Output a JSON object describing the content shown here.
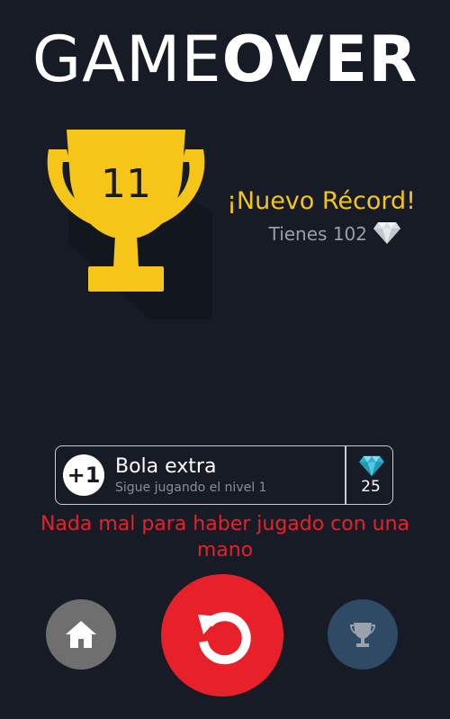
{
  "title": {
    "part1": "GAME",
    "part2": "OVER"
  },
  "score": "11",
  "new_record": "¡Nuevo Récord!",
  "gems": {
    "label": "Tienes 102"
  },
  "extra_ball": {
    "icon_text": "+1",
    "title": "Bola extra",
    "subtitle": "Sigue jugando el nivel 1",
    "price": "25"
  },
  "message": "Nada mal para haber jugado con una mano",
  "colors": {
    "background": "#161b25",
    "trophy": "#f5c518",
    "accent_red": "#e8202a",
    "gem": "#3fc0d8"
  },
  "icons": {
    "trophy": "trophy-icon",
    "gem": "diamond-icon",
    "home": "home-icon",
    "retry": "restart-icon",
    "leaderboard": "trophy-small-icon"
  }
}
